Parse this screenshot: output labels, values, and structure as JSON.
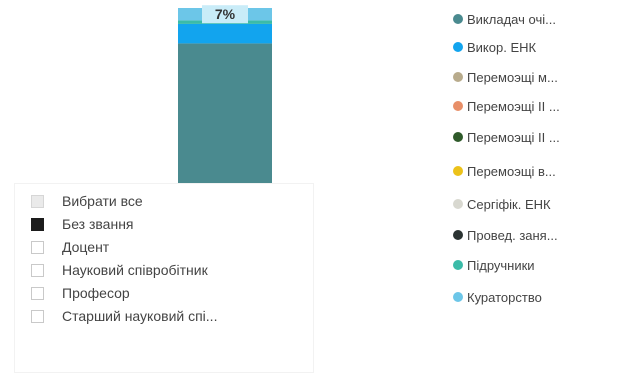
{
  "chart_data": {
    "type": "bar",
    "stacked": true,
    "categories": [
      ""
    ],
    "series": [
      {
        "name": "Викладач очі...",
        "color": "#4a8a8f",
        "values": [
          80
        ]
      },
      {
        "name": "Викор. ЕНК",
        "color": "#12a4ee",
        "values": [
          11
        ]
      },
      {
        "name": "Підручники",
        "color": "#3bbba8",
        "values": [
          2
        ]
      },
      {
        "name": "Кураторство",
        "color": "#6cc6e8",
        "values": [
          7
        ]
      }
    ],
    "data_labels": [
      "7%"
    ],
    "ylim": [
      0,
      100
    ]
  },
  "legend": {
    "items": [
      {
        "label": "Викладач очі...",
        "color": "#4a8a8f"
      },
      {
        "label": "Викор. ЕНК",
        "color": "#12a4ee"
      },
      {
        "label": "Перемоэщі м...",
        "color": "#b8ab8c"
      },
      {
        "label": "Перемоэщі ІІ ...",
        "color": "#e88f68"
      },
      {
        "label": "Перемоэщі ІІ ...",
        "color": "#2f5a2a"
      },
      {
        "label": "Перемоэщі в...",
        "color": "#ecc21a"
      },
      {
        "label": "Сергіфік. ЕНК",
        "color": "#d8d8d0"
      },
      {
        "label": "Провед. заня...",
        "color": "#2b3332"
      },
      {
        "label": "Підручники",
        "color": "#3bbba8"
      },
      {
        "label": "Кураторство",
        "color": "#6cc6e8"
      }
    ]
  },
  "slicer": {
    "items": [
      {
        "label": "Вибрати все",
        "state": "partial"
      },
      {
        "label": "Без звання",
        "state": "checked"
      },
      {
        "label": "Доцент",
        "state": "unchecked"
      },
      {
        "label": "Науковий співробітник",
        "state": "unchecked"
      },
      {
        "label": "Професор",
        "state": "unchecked"
      },
      {
        "label": "Старший науковий спі...",
        "state": "unchecked"
      }
    ]
  }
}
